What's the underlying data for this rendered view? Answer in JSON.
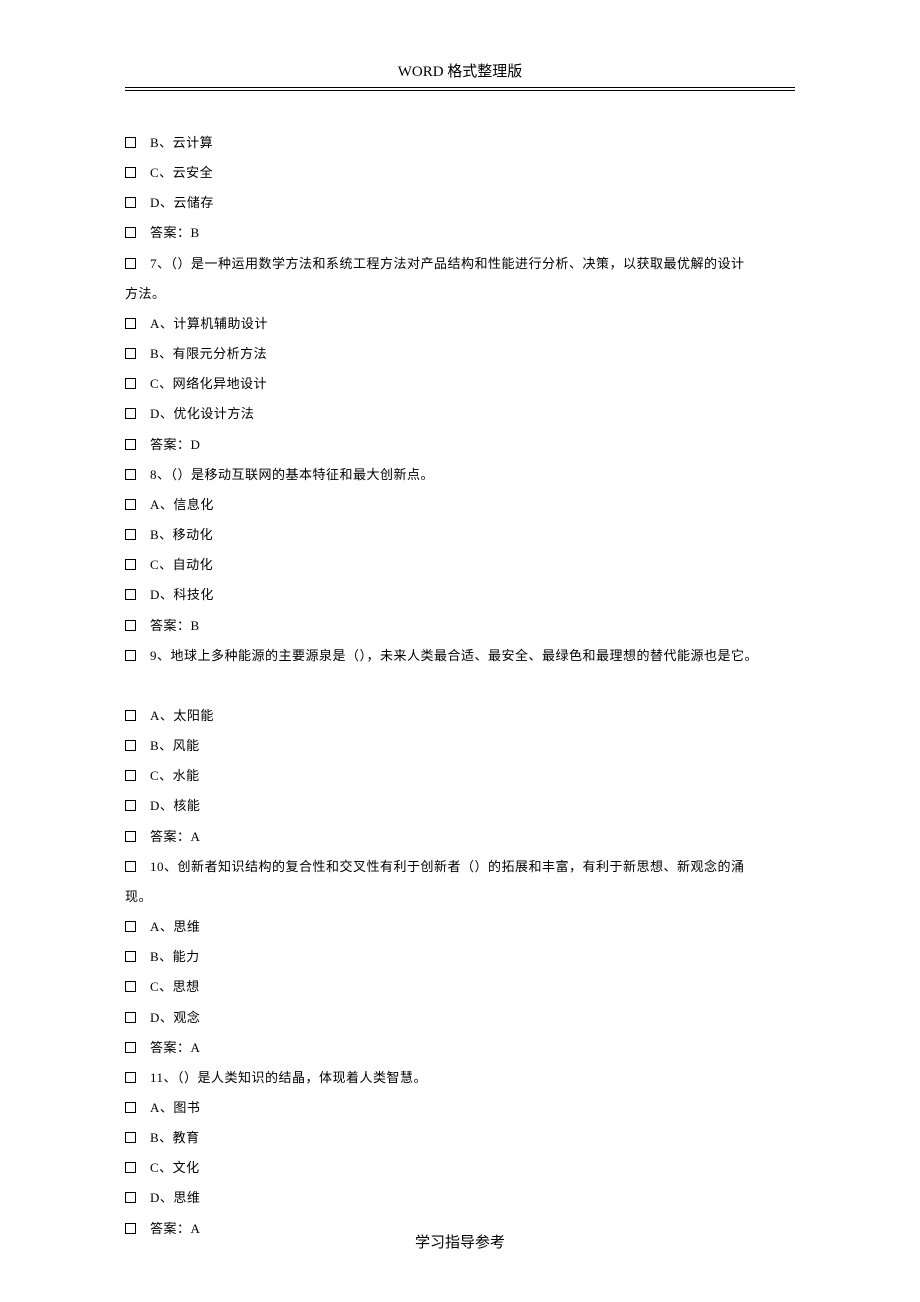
{
  "header": "WORD 格式整理版",
  "footer": "学习指导参考",
  "lines": [
    {
      "cb": true,
      "text": "B、云计算"
    },
    {
      "cb": true,
      "text": "C、云安全"
    },
    {
      "cb": true,
      "text": "D、云储存"
    },
    {
      "cb": true,
      "text": "答案：B"
    },
    {
      "cb": true,
      "text": "7、（）是一种运用数学方法和系统工程方法对产品结构和性能进行分析、决策，以获取最优解的设计"
    },
    {
      "cb": false,
      "text": "方法。"
    },
    {
      "cb": true,
      "text": "A、计算机辅助设计"
    },
    {
      "cb": true,
      "text": "B、有限元分析方法"
    },
    {
      "cb": true,
      "text": "C、网络化异地设计"
    },
    {
      "cb": true,
      "text": "D、优化设计方法"
    },
    {
      "cb": true,
      "text": "答案：D"
    },
    {
      "cb": true,
      "text": "8、（）是移动互联网的基本特征和最大创新点。"
    },
    {
      "cb": true,
      "text": "A、信息化"
    },
    {
      "cb": true,
      "text": "B、移动化"
    },
    {
      "cb": true,
      "text": "C、自动化"
    },
    {
      "cb": true,
      "text": "D、科技化"
    },
    {
      "cb": true,
      "text": "答案：B"
    },
    {
      "cb": true,
      "text": "9、地球上多种能源的主要源泉是（），未来人类最合适、最安全、最绿色和最理想的替代能源也是它。"
    },
    {
      "cb": false,
      "text": " "
    },
    {
      "cb": true,
      "text": "A、太阳能"
    },
    {
      "cb": true,
      "text": "B、风能"
    },
    {
      "cb": true,
      "text": "C、水能"
    },
    {
      "cb": true,
      "text": "D、核能"
    },
    {
      "cb": true,
      "text": "答案：A"
    },
    {
      "cb": true,
      "text": "10、创新者知识结构的复合性和交叉性有利于创新者（）的拓展和丰富，有利于新思想、新观念的涌"
    },
    {
      "cb": false,
      "text": "现。"
    },
    {
      "cb": true,
      "text": "A、思维"
    },
    {
      "cb": true,
      "text": "B、能力"
    },
    {
      "cb": true,
      "text": "C、思想"
    },
    {
      "cb": true,
      "text": "D、观念"
    },
    {
      "cb": true,
      "text": "答案：A"
    },
    {
      "cb": true,
      "text": "11、（）是人类知识的结晶，体现着人类智慧。"
    },
    {
      "cb": true,
      "text": "A、图书"
    },
    {
      "cb": true,
      "text": "B、教育"
    },
    {
      "cb": true,
      "text": "C、文化"
    },
    {
      "cb": true,
      "text": "D、思维"
    },
    {
      "cb": true,
      "text": "答案：A"
    }
  ]
}
